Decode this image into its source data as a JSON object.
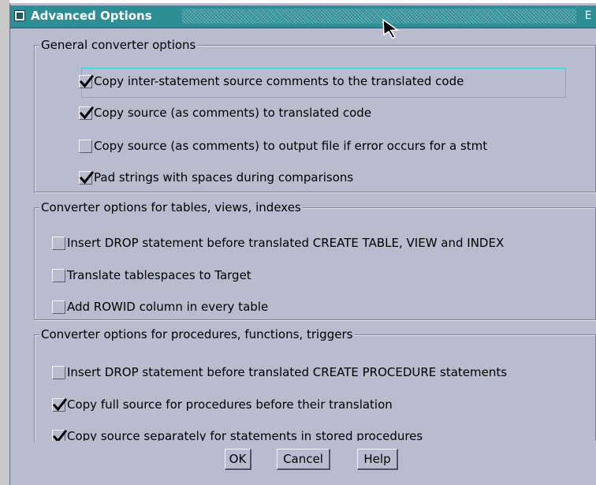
{
  "window": {
    "title": "Advanced Options",
    "right_glyph": "E"
  },
  "groups": [
    {
      "title": "General converter options",
      "options": [
        {
          "label": "Copy inter-statement source comments to the translated code",
          "checked": true
        },
        {
          "label": "Copy source (as comments) to translated code",
          "checked": true
        },
        {
          "label": "Copy source (as comments) to output file if error occurs for a stmt",
          "checked": false
        },
        {
          "label": "Pad strings with spaces during comparisons",
          "checked": true
        }
      ]
    },
    {
      "title": "Converter options for tables, views, indexes",
      "options": [
        {
          "label": "Insert DROP statement before translated CREATE TABLE, VIEW and INDEX",
          "checked": false
        },
        {
          "label": "Translate tablespaces to Target",
          "checked": false
        },
        {
          "label": "Add ROWID column in every table",
          "checked": false
        }
      ]
    },
    {
      "title": "Converter options for procedures, functions, triggers",
      "options": [
        {
          "label": "Insert DROP statement before translated CREATE PROCEDURE statements",
          "checked": false
        },
        {
          "label": "Copy full source for procedures before their translation",
          "checked": true
        },
        {
          "label": "Copy source separately for statements in stored procedures",
          "checked": true
        }
      ]
    }
  ],
  "buttons": {
    "ok": "OK",
    "cancel": "Cancel",
    "help": "Help"
  },
  "colors": {
    "dialog_bg": "#b8bcce",
    "titlebar": "#2e8e96",
    "focus": "#2fd3dc"
  }
}
